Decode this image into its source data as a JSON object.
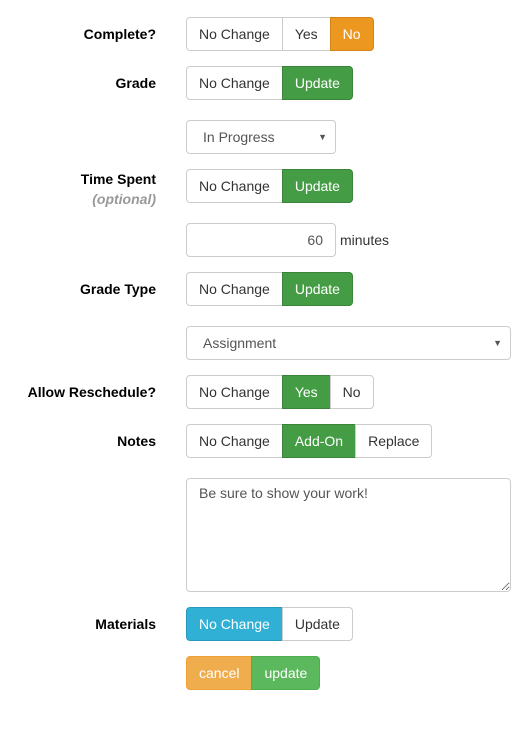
{
  "fields": {
    "complete": {
      "label": "Complete?",
      "options": [
        "No Change",
        "Yes",
        "No"
      ],
      "selected": "No"
    },
    "grade": {
      "label": "Grade",
      "options": [
        "No Change",
        "Update"
      ],
      "selected": "Update",
      "select_value": "In Progress"
    },
    "time_spent": {
      "label": "Time Spent",
      "sublabel": "(optional)",
      "options": [
        "No Change",
        "Update"
      ],
      "selected": "Update",
      "value": "60",
      "unit": "minutes"
    },
    "grade_type": {
      "label": "Grade Type",
      "options": [
        "No Change",
        "Update"
      ],
      "selected": "Update",
      "select_value": "Assignment"
    },
    "allow_reschedule": {
      "label": "Allow Reschedule?",
      "options": [
        "No Change",
        "Yes",
        "No"
      ],
      "selected": "Yes"
    },
    "notes": {
      "label": "Notes",
      "options": [
        "No Change",
        "Add-On",
        "Replace"
      ],
      "selected": "Add-On",
      "value": "Be sure to show your work!"
    },
    "materials": {
      "label": "Materials",
      "options": [
        "No Change",
        "Update"
      ],
      "selected": "No Change"
    }
  },
  "actions": {
    "cancel": "cancel",
    "update": "update"
  },
  "icons": {
    "caret": "▼"
  }
}
